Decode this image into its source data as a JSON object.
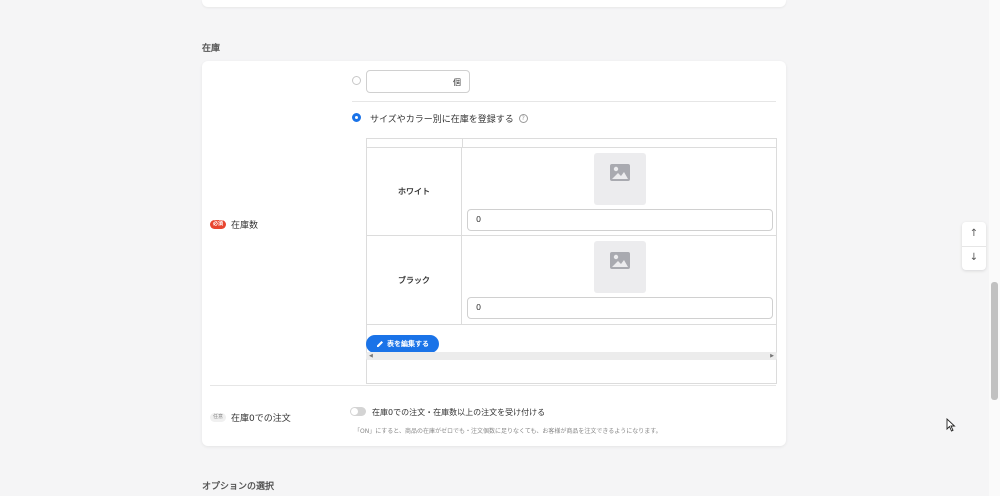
{
  "sections": {
    "inventory_title": "在庫",
    "options_title": "オプションの選択"
  },
  "stock": {
    "badge_required": "必須",
    "label": "在庫数",
    "unit": "個",
    "variant_option_label": "サイズやカラー別に在庫を登録する",
    "help": "?",
    "variants": [
      {
        "name": "ホワイト",
        "quantity": "0"
      },
      {
        "name": "ブラック",
        "quantity": "0"
      }
    ],
    "edit_table_button": "表を編集する"
  },
  "zero_stock": {
    "badge_optional": "任意",
    "label": "在庫0での注文",
    "toggle_label": "在庫0での注文・在庫数以上の注文を受け付ける",
    "note": "「ON」にすると、商品の在庫がゼロでも・注文個数に足りなくても、お客様が商品を注文できるようになります。"
  },
  "nav": {
    "up": "↑",
    "down": "↓"
  },
  "colors": {
    "accent": "#1a73e8",
    "required_badge": "#e8452f"
  }
}
